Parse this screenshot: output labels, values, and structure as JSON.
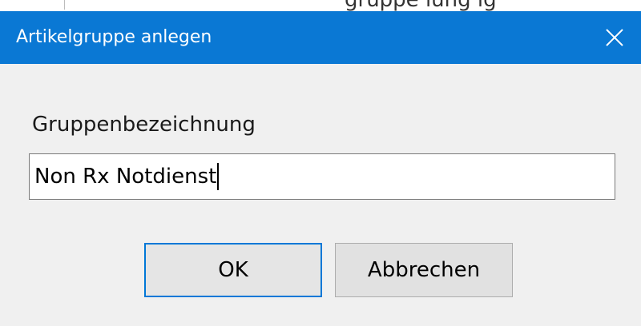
{
  "background": {
    "fragment_text": "gruppe       lung  ig"
  },
  "dialog": {
    "title": "Artikelgruppe anlegen",
    "close_icon": "close-icon",
    "titlebar_color": "#0a78d4",
    "field": {
      "label": "Gruppenbezeichnung",
      "value": "Non Rx Notdienst"
    },
    "buttons": {
      "ok_label": "OK",
      "cancel_label": "Abbrechen"
    },
    "accent_color": "#0078d7"
  }
}
